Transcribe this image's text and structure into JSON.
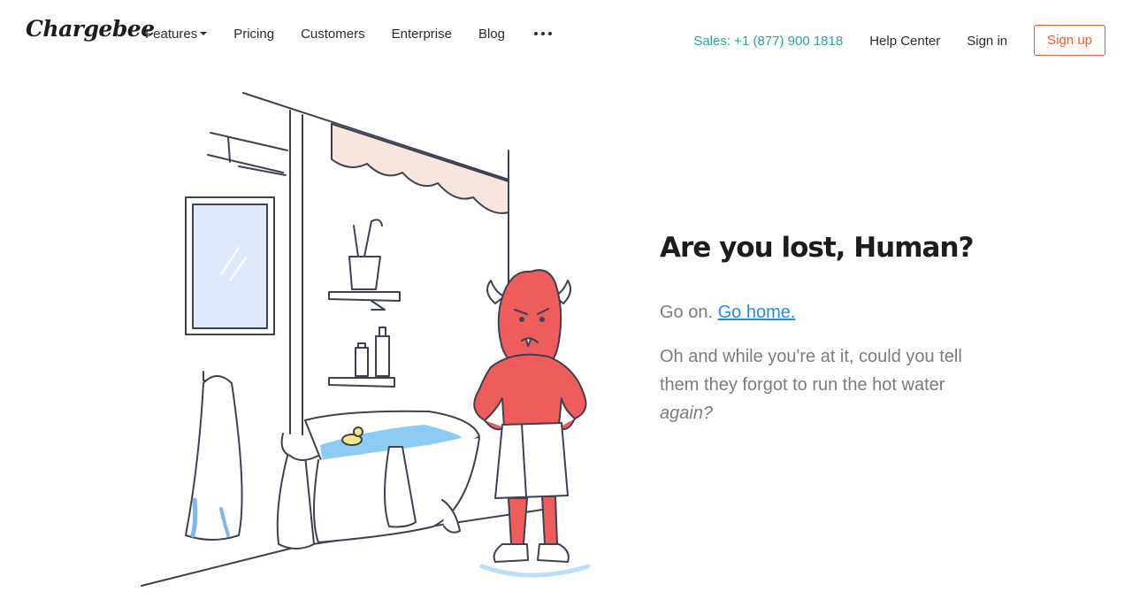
{
  "header": {
    "logo": "Chargebee",
    "nav": [
      {
        "label": "Features",
        "has_dropdown": true
      },
      {
        "label": "Pricing"
      },
      {
        "label": "Customers"
      },
      {
        "label": "Enterprise"
      },
      {
        "label": "Blog"
      }
    ],
    "more_icon": "more-dots-icon",
    "sales": "Sales: +1 (877) 900 1818",
    "help_center": "Help Center",
    "sign_in": "Sign in",
    "sign_up": "Sign up"
  },
  "main": {
    "heading": "Are you lost, Human?",
    "go_on_prefix": "Go on.",
    "go_home_link": "Go home.",
    "paragraph_text": "Oh and while you're at it, could you tell them they forgot to run the hot water",
    "paragraph_emphasis": "again?"
  },
  "colors": {
    "accent_teal": "#2aa59a",
    "signup_orange": "#f05a28",
    "link_blue": "#2e8bda",
    "monster_red": "#ee5d5b"
  }
}
